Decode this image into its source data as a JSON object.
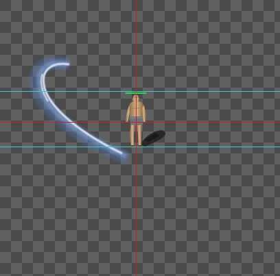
{
  "scene": {
    "background": "transparency-checkerboard",
    "checker_light": "#606060",
    "checker_dark": "#4a4a4a",
    "guide_color": "#c8202a",
    "bounds_color": "#3fc7d6",
    "health_bar_color": "#22e04a",
    "health_fraction": 1.0,
    "effect": "slash-arc-trail",
    "effect_color": "#9fc4ff",
    "character": "bald-fighter-idle",
    "shadow": "drop-shadow"
  }
}
